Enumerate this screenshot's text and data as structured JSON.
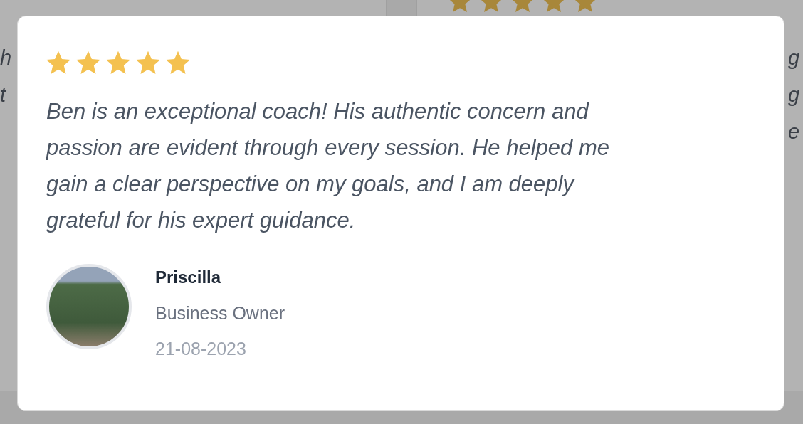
{
  "background_cards": [
    {
      "text_lines": [
        "h",
        "t"
      ]
    },
    {
      "stars": 5,
      "text_lines": [
        "g",
        "g",
        "e"
      ]
    }
  ],
  "testimonial": {
    "stars": 5,
    "quote": "Ben is an exceptional coach! His authentic concern and passion are evident through every session. He helped me gain a clear perspective on my goals, and I am deeply grateful for his expert guidance.",
    "author": {
      "name": "Priscilla",
      "role": "Business Owner",
      "date": "21-08-2023"
    }
  }
}
